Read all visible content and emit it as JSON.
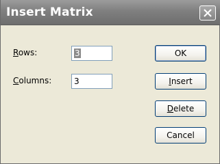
{
  "window": {
    "title": "Insert Matrix"
  },
  "form": {
    "rows_label_accel": "R",
    "rows_label_rest": "ows:",
    "rows_value": "3",
    "columns_label_accel": "C",
    "columns_label_rest": "olumns:",
    "columns_value": "3"
  },
  "buttons": {
    "ok_label": "OK",
    "insert_accel": "I",
    "insert_rest": "nsert",
    "delete_accel": "D",
    "delete_rest": "elete",
    "cancel_label": "Cancel"
  },
  "icons": {
    "close": "close-icon"
  }
}
